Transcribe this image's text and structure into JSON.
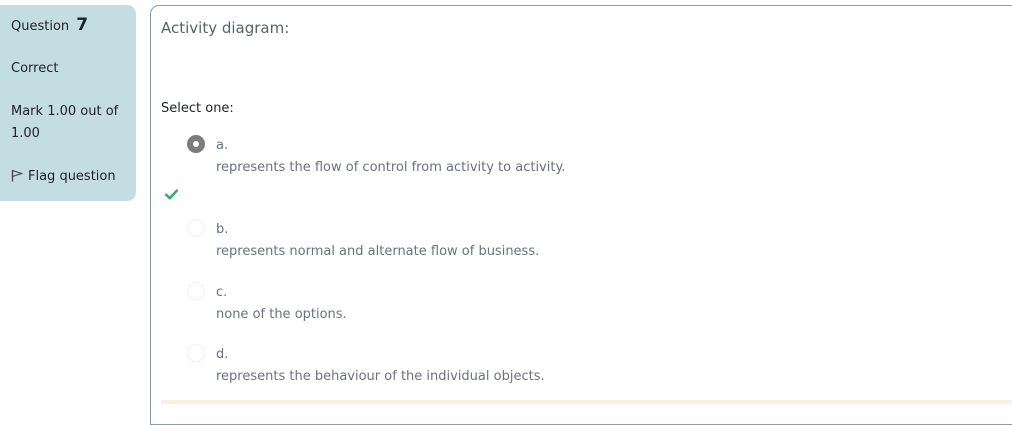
{
  "info": {
    "question_label": "Question",
    "question_number": "7",
    "state": "Correct",
    "grade": "Mark 1.00 out of 1.00",
    "flag_label": "Flag question"
  },
  "question": {
    "text": "Activity diagram:",
    "prompt": "Select one:",
    "options": [
      {
        "letter": "a.",
        "text": "represents the flow of control from activity to activity.",
        "selected": true,
        "correct": true
      },
      {
        "letter": "b.",
        "text": "represents normal and alternate flow of business.",
        "selected": false
      },
      {
        "letter": "c.",
        "text": "none of the options.",
        "selected": false
      },
      {
        "letter": "d.",
        "text": "represents the behaviour of the individual objects.",
        "selected": false
      }
    ]
  },
  "icons": {
    "flag": "flag-icon",
    "correct": "check-icon"
  },
  "colors": {
    "info_panel": "#c4dde3",
    "correct_check": "#3eaa6a",
    "selected_radio": "#7d7d7d"
  }
}
